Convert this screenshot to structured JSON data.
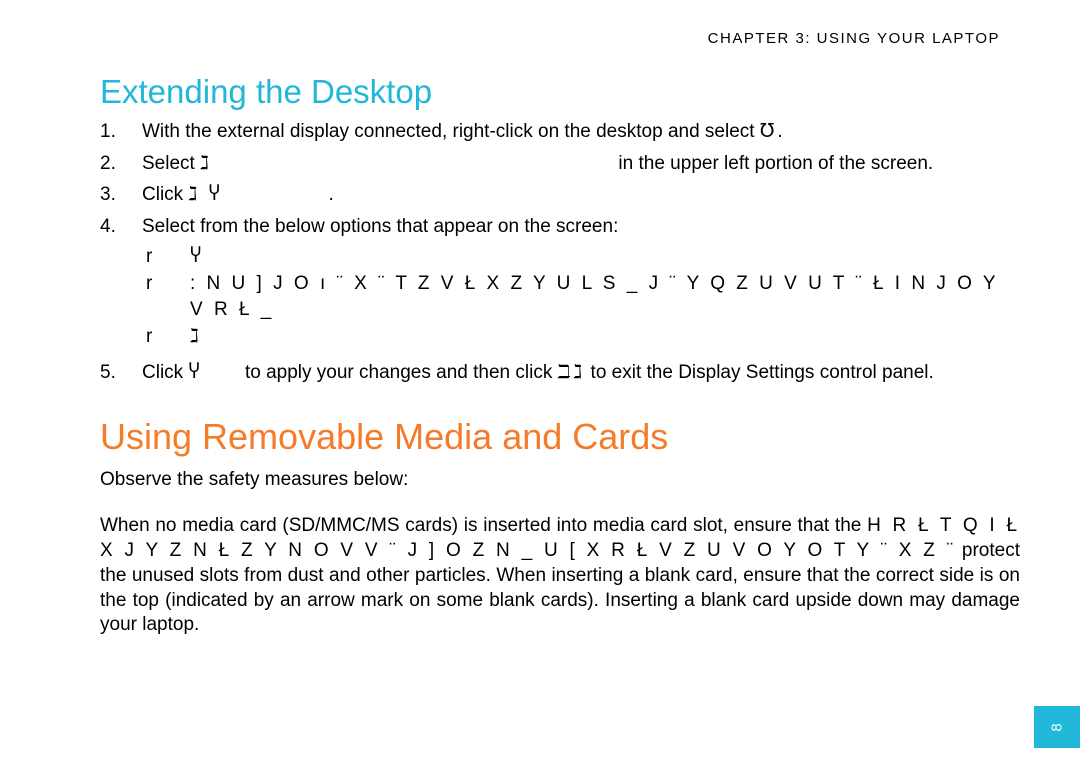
{
  "chapter": "CHAPTER 3: USING YOUR LAPTOP",
  "section1": {
    "title": "Extending the Desktop",
    "steps": [
      {
        "n": "1.",
        "text_a": "With the external display connected, right-click on the desktop and select ",
        "glyph": "℧",
        "text_b": "."
      },
      {
        "n": "2.",
        "text_a": "Select ",
        "glyph": "ℷ",
        "text_b": "                                                                             in the upper left portion of the screen."
      },
      {
        "n": "3.",
        "text_a": "Click ",
        "glyph": "ℷ Ⴤ",
        "text_b": "                    ."
      },
      {
        "n": "4.",
        "text_a": "Select from the below options that appear on the screen:",
        "bullets": [
          {
            "m": "r",
            "t": "Ⴤ"
          },
          {
            "m": "r",
            "t": ": N U ]  J O ı ¨ X ¨ T Z  V Ł X Z Y  U L  S _  J ¨ Y Q Z U V  U T  ¨ Ł I N  J O Y V R Ł _"
          },
          {
            "m": "r",
            "t": "ℷ"
          }
        ]
      },
      {
        "n": "5.",
        "text_a": "Click ",
        "glyph": "Ⴤ",
        "text_mid": "        to apply your changes and then click ",
        "glyph2": "ℶℷ",
        "text_b": " to exit the Display Settings control panel."
      }
    ]
  },
  "section2": {
    "title": "Using Removable Media and Cards",
    "intro": "Observe the safety measures below:",
    "para1": "When no media card (SD/MMC/MS cards) is inserted into media card slot, ensure that the",
    "garbled": " H R Ł T Q  I Ł X J Y  Z N Ł Z  Y N O V V ¨ J  ] O Z N  _ U [ X  R Ł V Z U V  O Y  O T Y ¨ X Z ¨",
    "para2": "protect the unused slots from dust and other particles. When inserting a blank card, ensure that the correct side is on the top (indicated by an arrow mark on some blank cards). Inserting a blank card upside down may damage your laptop."
  },
  "page_number": "8"
}
